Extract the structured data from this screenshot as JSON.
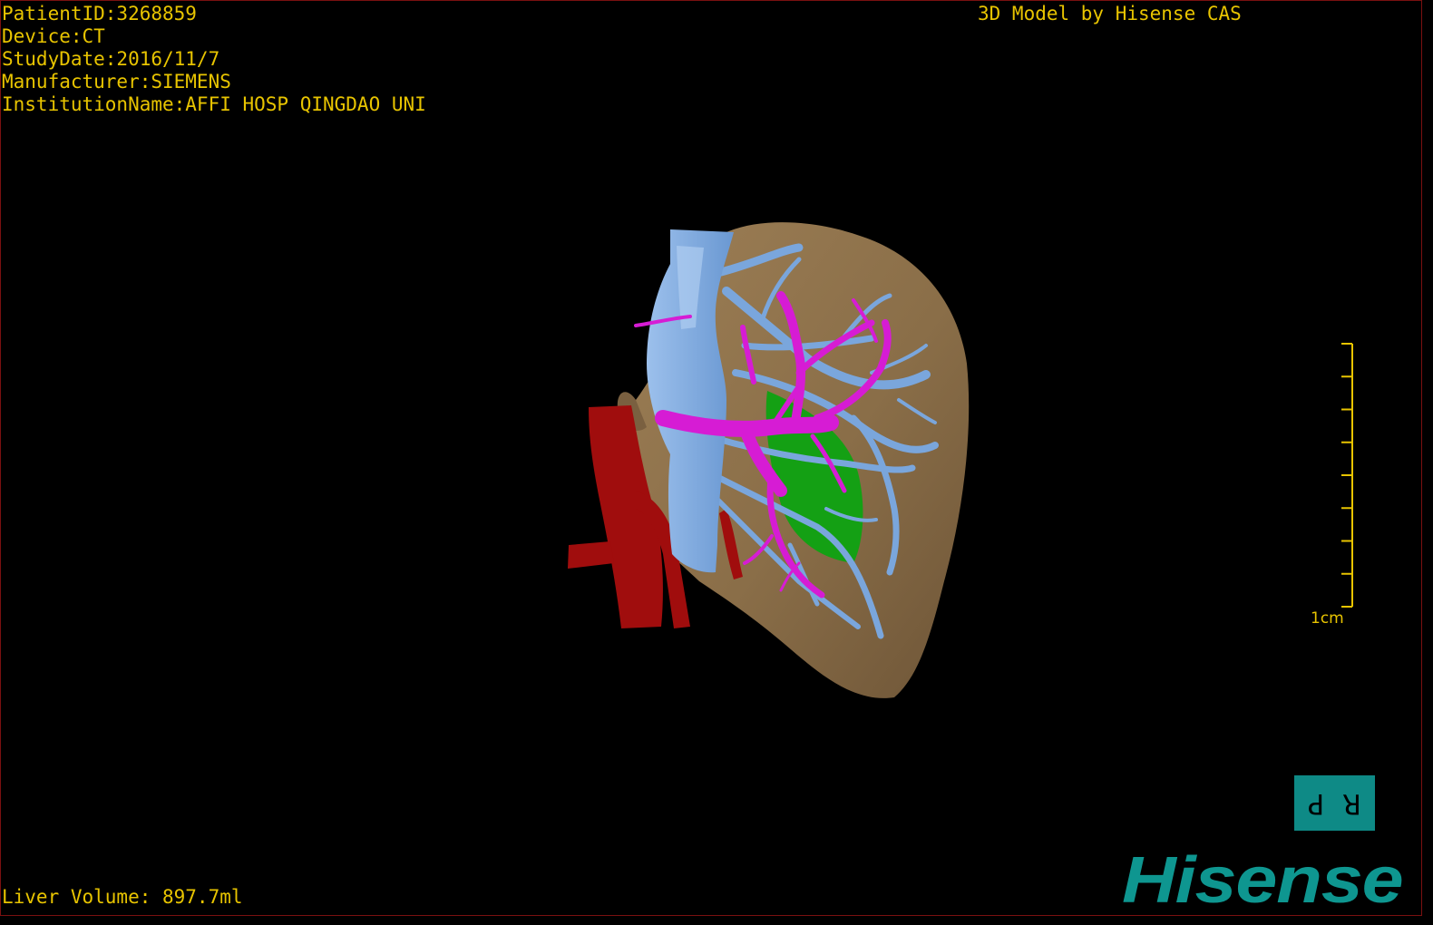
{
  "dicom_info": {
    "patient_id": "PatientID:3268859",
    "device": "Device:CT",
    "study_date": "StudyDate:2016/11/7",
    "manufacturer": "Manufacturer:SIEMENS",
    "institution": "InstitutionName:AFFI HOSP QINGDAO UNI"
  },
  "vendor_caption": "3D Model by Hisense CAS",
  "scale": {
    "label": "1cm",
    "tick_count": 9
  },
  "orientation": {
    "left_letter": "P",
    "right_letter": "R"
  },
  "liver_volume": "Liver Volume: 897.7ml",
  "brand": "Hisense",
  "model": {
    "structures": [
      "liver",
      "inferior vena cava",
      "hepatic veins",
      "portal vein",
      "aorta",
      "tumor"
    ],
    "colors": {
      "liver": "#8a6e48",
      "hepatic_veins": "#7aa6dc",
      "portal_vein": "#d61cd4",
      "aorta": "#a00d0d",
      "tumor": "#14a014",
      "overlay_text": "#e8c400",
      "logo": "#0e9690",
      "orientation_cube": "#0e8a86"
    }
  }
}
